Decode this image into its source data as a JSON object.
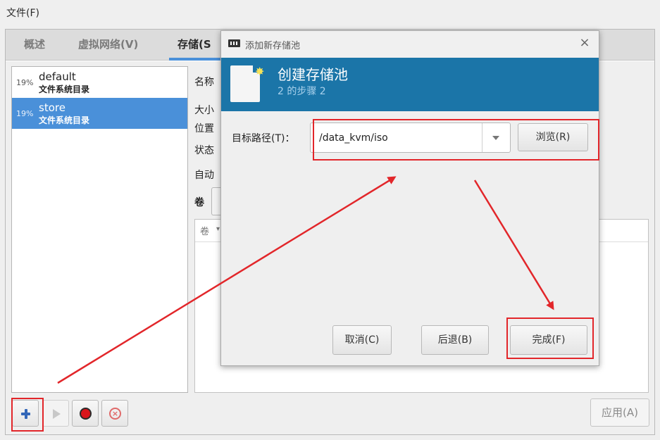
{
  "menubar": {
    "file_label": "文件(F)"
  },
  "tabs": [
    {
      "label": "概述"
    },
    {
      "label": "虚拟网络(V)"
    },
    {
      "label": "存储(S"
    }
  ],
  "pools": [
    {
      "percent": "19%",
      "name": "default",
      "type": "文件系统目录"
    },
    {
      "percent": "19%",
      "name": "store",
      "type": "文件系统目录"
    }
  ],
  "details": {
    "name_label": "名称",
    "size_label": "大小",
    "location_label": "位置",
    "state_label": "状态",
    "autostart_label": "自动",
    "volumes_label": "卷",
    "volume_column": "卷"
  },
  "toolbar": {
    "apply_label": "应用(A)"
  },
  "dialog": {
    "title": "添加新存储池",
    "close_glyph": "×",
    "banner_title": "创建存储池",
    "banner_step": "2 的步骤 2",
    "path_label": "目标路径(T)：",
    "path_value": "/data_kvm/iso",
    "browse_label": "浏览(R)",
    "cancel_label": "取消(C)",
    "back_label": "后退(B)",
    "finish_label": "完成(F)"
  },
  "colors": {
    "accent": "#4a90d9",
    "banner": "#1b75a8",
    "annotation": "#e2262a",
    "stop_red": "#d9141b"
  },
  "icons": [
    "add-icon",
    "play-icon",
    "stop-icon",
    "delete-icon",
    "app-icon",
    "close-icon",
    "document-icon",
    "star-icon",
    "dropdown-arrow-icon"
  ]
}
